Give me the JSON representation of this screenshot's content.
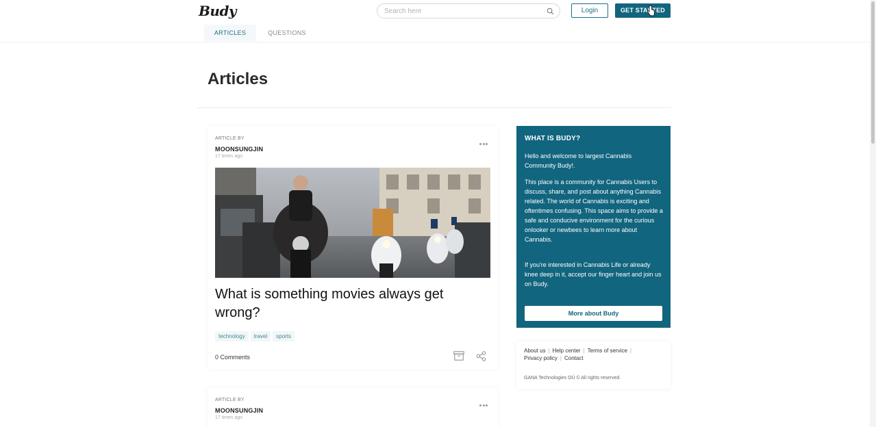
{
  "header": {
    "logo": "Budy",
    "search_placeholder": "Search here",
    "login_label": "Login",
    "get_started_label": "GET STARTED"
  },
  "tabs": [
    {
      "label": "ARTICLES",
      "active": true
    },
    {
      "label": "QUESTIONS",
      "active": false
    }
  ],
  "main": {
    "title": "Articles",
    "articles": [
      {
        "byline": "ARTICLE BY",
        "author": "MOONSUNGJIN",
        "time": "17 times ago",
        "title": "What is something movies always get wrong?",
        "tags": [
          "technology",
          "travel",
          "sports"
        ],
        "comments": "0 Comments",
        "image_icon": "photo-motorcycle-street"
      },
      {
        "byline": "ARTICLE BY",
        "author": "MOONSUNGJIN",
        "time": "17 times ago"
      }
    ]
  },
  "sidebar": {
    "about": {
      "heading": "WHAT IS BUDY?",
      "p1": "Hello and welcome to largest Cannabis Community Budy!.",
      "p2": "This place is a community for Cannabis Users to discuss, share, and post about anything Cannabis related. The world of Cannabis is exciting and oftentimes confusing. This space aims to provide a safe and conducive environment for the curious onlooker or newbees to learn more about Cannabis.",
      "p3": "If you're interested in Cannabis Life or already knee deep in it, accept our finger heart and join us on Budy.",
      "button_label": "More about Budy"
    },
    "footer": {
      "links": [
        "About us",
        "Help center",
        "Terms of service",
        "Privacy policy",
        "Contact"
      ],
      "separator": "|",
      "copyright": "GANA Technologies OÜ © All rights reserved."
    }
  },
  "colors": {
    "brand": "#12657e",
    "tag_text": "#3c8a93",
    "tag_bg": "#f2f6f7"
  }
}
